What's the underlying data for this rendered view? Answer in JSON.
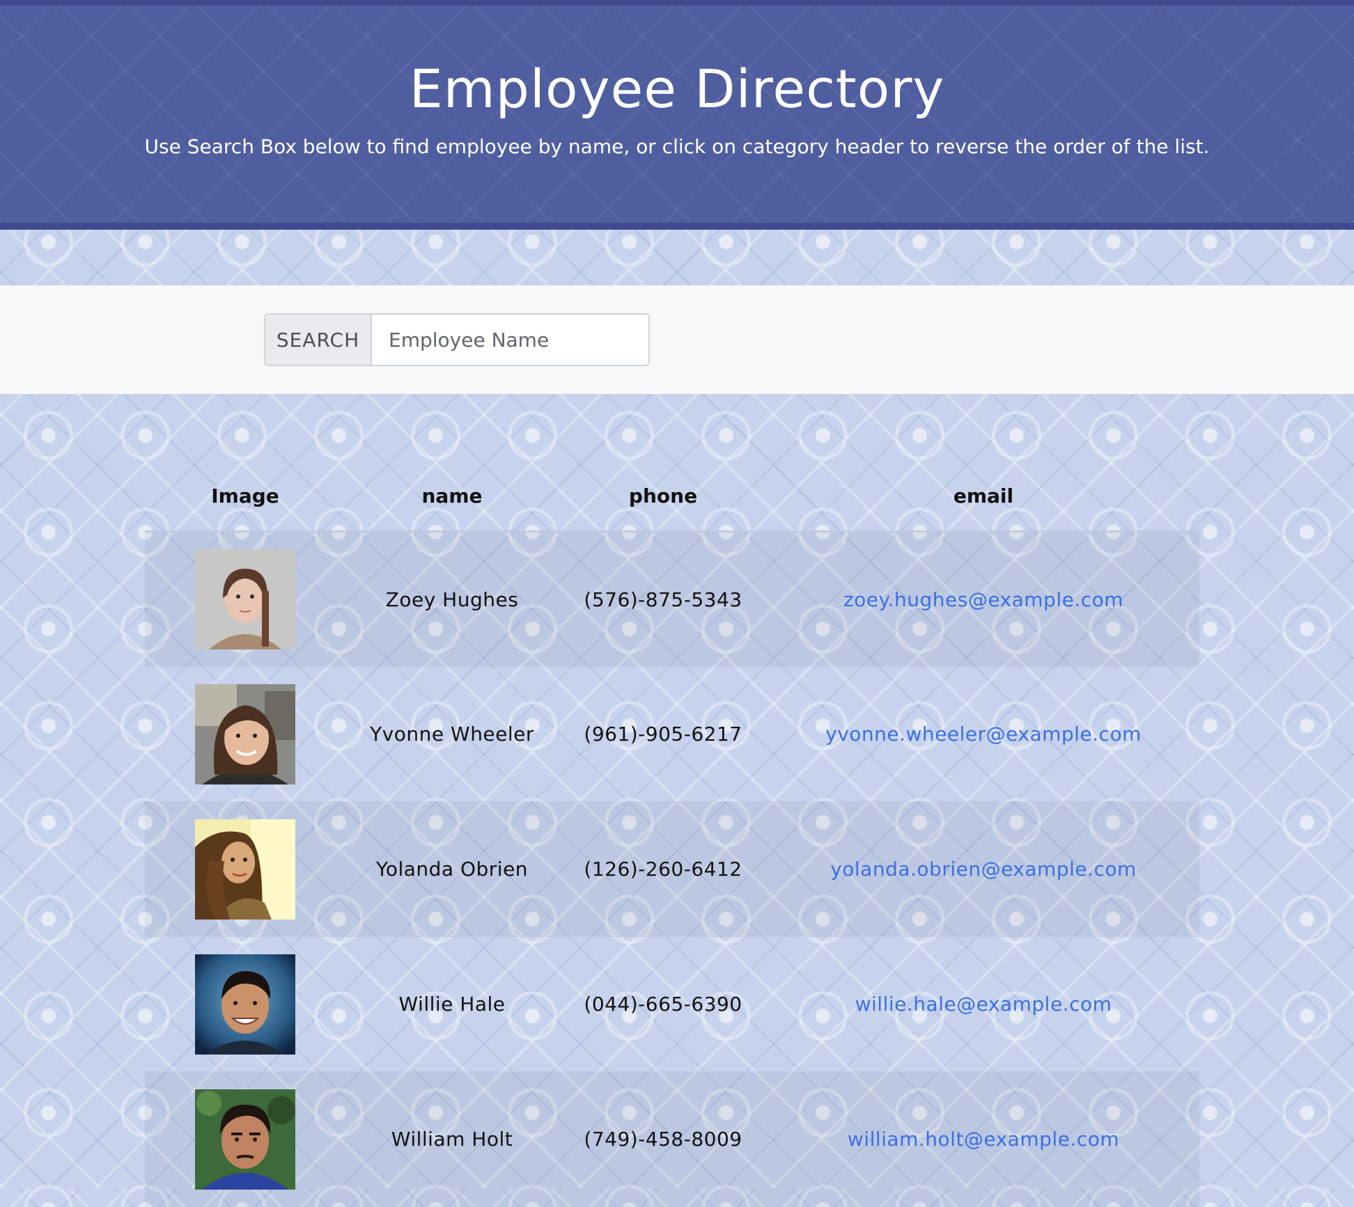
{
  "header": {
    "title": "Employee Directory",
    "subtitle": "Use Search Box below to find employee by name, or click on category header to reverse the order of the list."
  },
  "search": {
    "label": "SEARCH",
    "placeholder": "Employee Name",
    "value": ""
  },
  "table": {
    "columns": [
      "Image",
      "name",
      "phone",
      "email"
    ],
    "rows": [
      {
        "image": "employee-photo",
        "name": "Zoey Hughes",
        "phone": "(576)-875-5343",
        "email": "zoey.hughes@example.com"
      },
      {
        "image": "employee-photo",
        "name": "Yvonne Wheeler",
        "phone": "(961)-905-6217",
        "email": "yvonne.wheeler@example.com"
      },
      {
        "image": "employee-photo",
        "name": "Yolanda Obrien",
        "phone": "(126)-260-6412",
        "email": "yolanda.obrien@example.com"
      },
      {
        "image": "employee-photo",
        "name": "Willie Hale",
        "phone": "(044)-665-6390",
        "email": "willie.hale@example.com"
      },
      {
        "image": "employee-photo",
        "name": "William Holt",
        "phone": "(749)-458-8009",
        "email": "william.holt@example.com"
      }
    ]
  },
  "colors": {
    "header_bg": "#4f5e9f",
    "header_border": "#3f4b8e",
    "link": "#3b6fe0",
    "page_pattern": "#c7d3ec"
  }
}
